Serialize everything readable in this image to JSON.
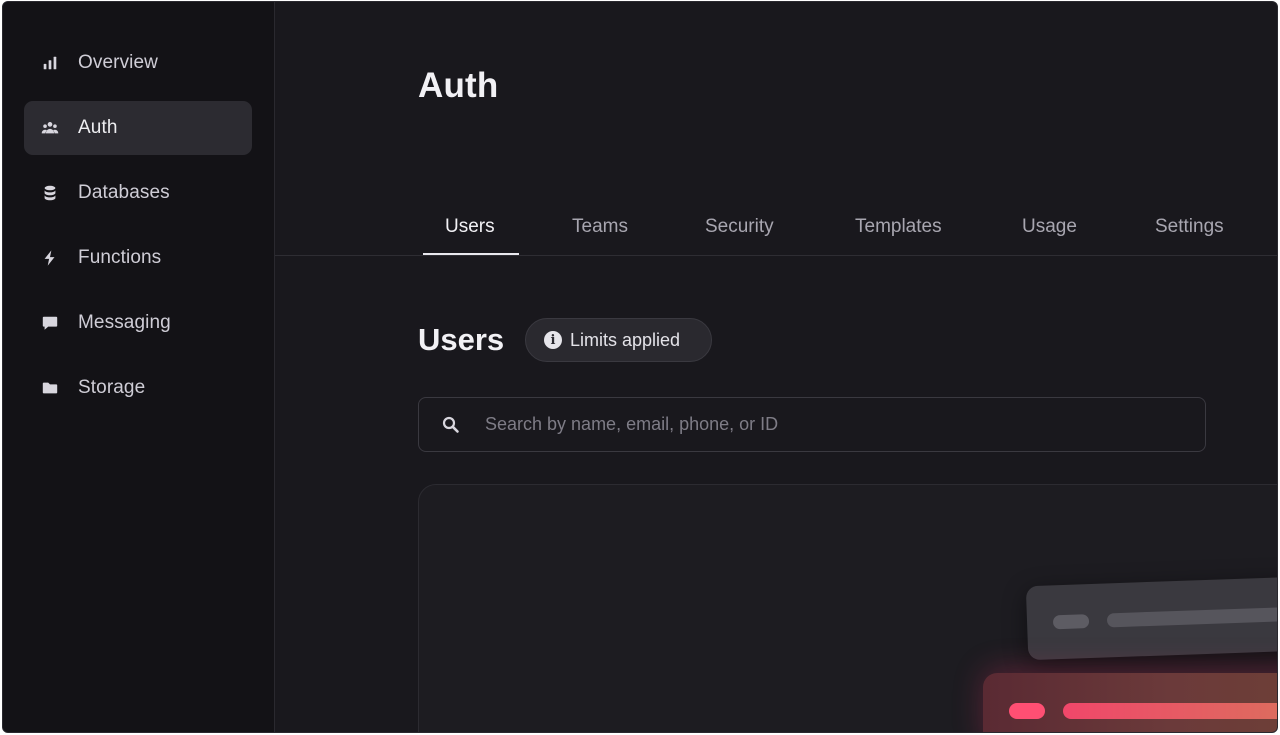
{
  "sidebar": {
    "items": [
      {
        "label": "Overview",
        "icon": "bar-chart-icon",
        "active": false
      },
      {
        "label": "Auth",
        "icon": "users-icon",
        "active": true
      },
      {
        "label": "Databases",
        "icon": "database-icon",
        "active": false
      },
      {
        "label": "Functions",
        "icon": "lightning-icon",
        "active": false
      },
      {
        "label": "Messaging",
        "icon": "chat-icon",
        "active": false
      },
      {
        "label": "Storage",
        "icon": "folder-icon",
        "active": false
      }
    ]
  },
  "page": {
    "title": "Auth"
  },
  "tabs": [
    {
      "label": "Users",
      "active": true
    },
    {
      "label": "Teams",
      "active": false
    },
    {
      "label": "Security",
      "active": false
    },
    {
      "label": "Templates",
      "active": false
    },
    {
      "label": "Usage",
      "active": false
    },
    {
      "label": "Settings",
      "active": false
    }
  ],
  "users_section": {
    "title": "Users",
    "badge": "Limits applied",
    "badge_icon": "info-icon"
  },
  "search": {
    "placeholder": "Search by name, email, phone, or ID",
    "value": ""
  },
  "colors": {
    "background": "#19181d",
    "sidebar": "#131216",
    "accent": "#fd366e"
  }
}
